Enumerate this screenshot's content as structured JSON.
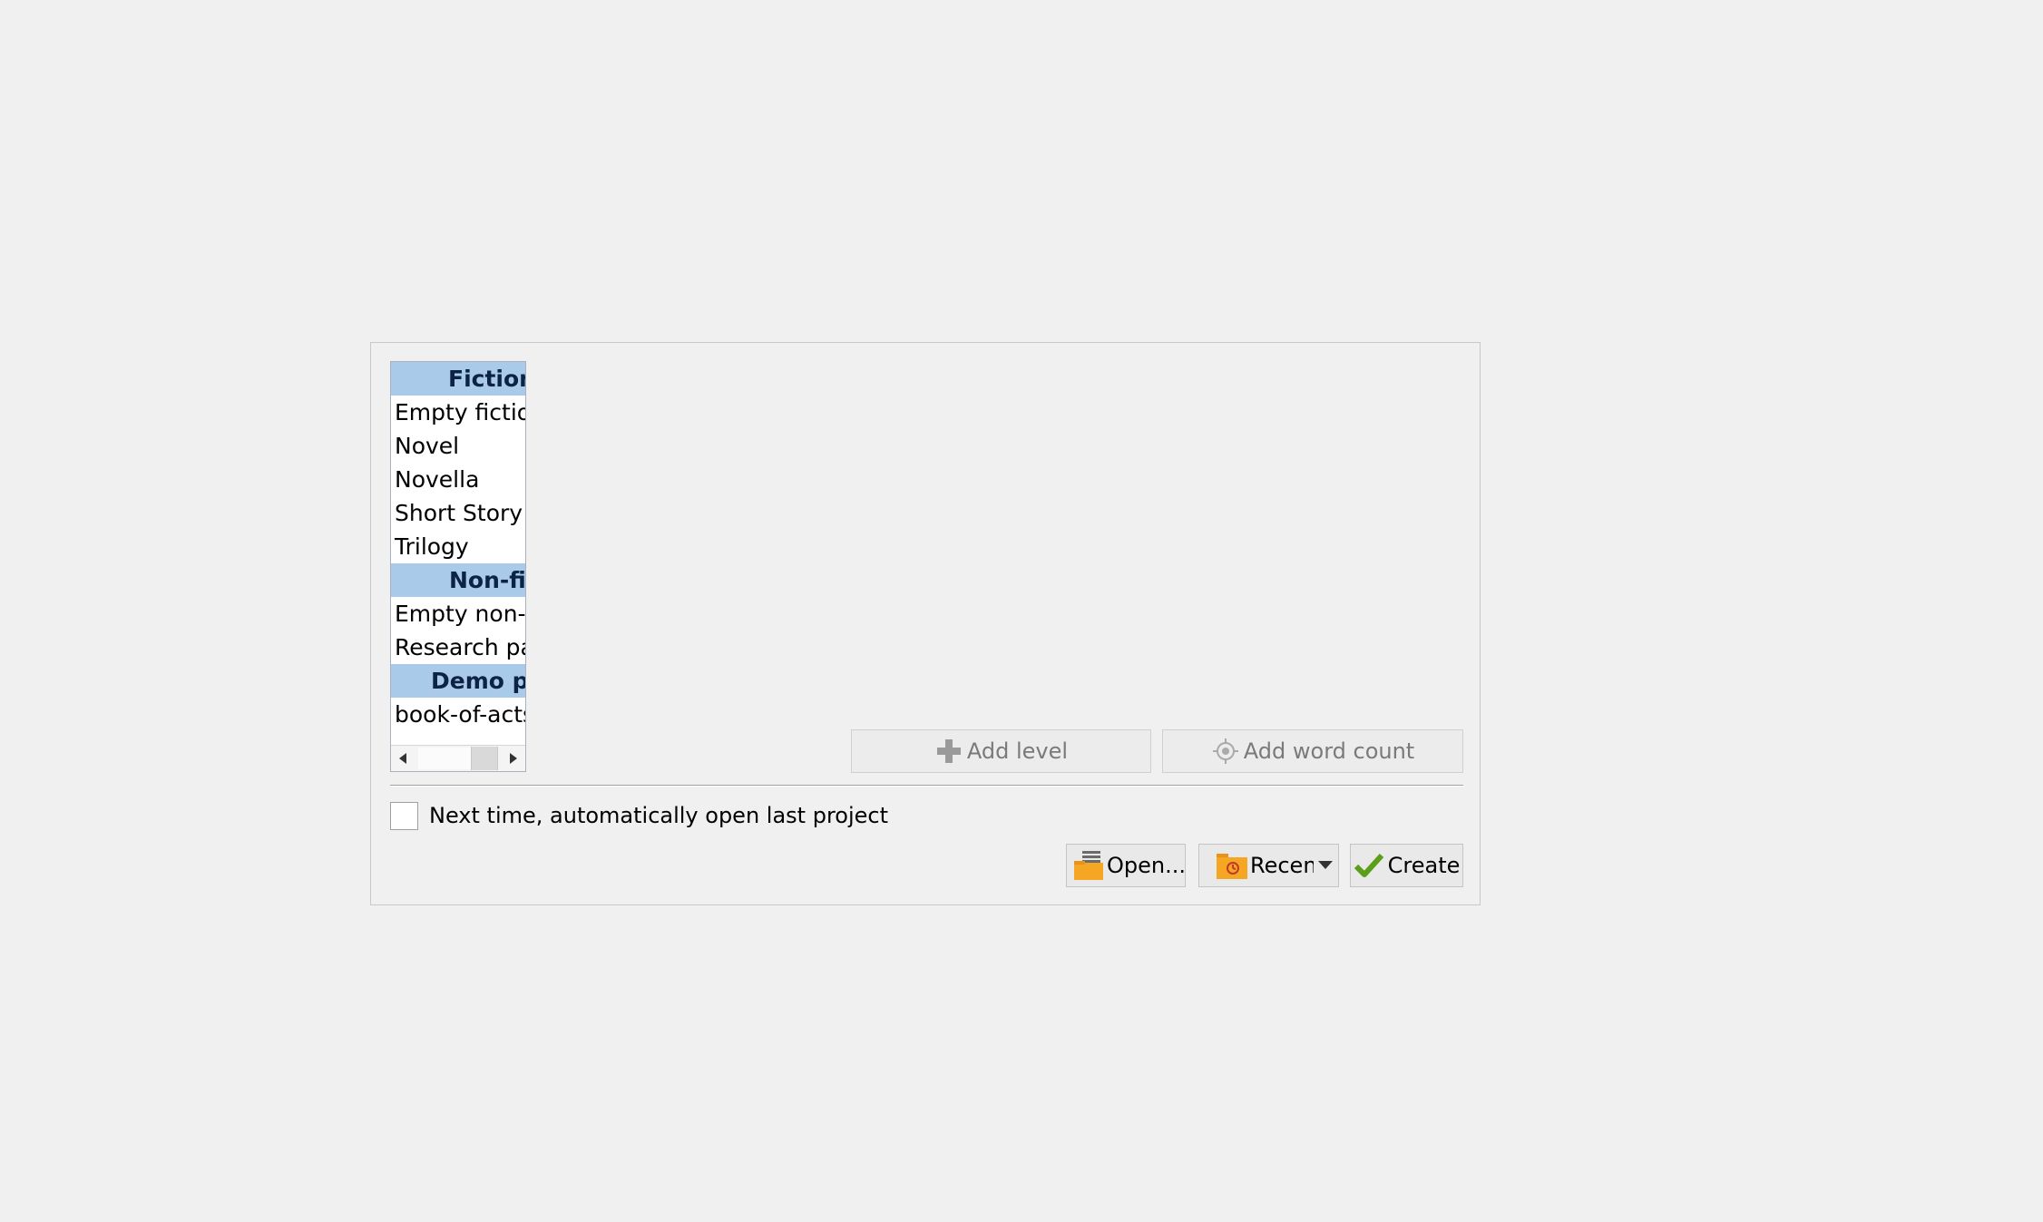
{
  "templates": {
    "groups": [
      {
        "header": "Fiction",
        "items": [
          "Empty fiction",
          "Novel",
          "Novella",
          "Short Story",
          "Trilogy"
        ]
      },
      {
        "header": "Non-fiction",
        "items": [
          "Empty non-fiction",
          "Research paper"
        ]
      },
      {
        "header": "Demo projects",
        "items": [
          "book-of-acts"
        ]
      }
    ]
  },
  "levels": {
    "add_level_label": "Add level",
    "add_word_count_label": "Add word count"
  },
  "options": {
    "auto_open_label": "Next time, automatically open last project",
    "auto_open_checked": false
  },
  "actions": {
    "open_label": "Open...",
    "recent_label": "Recent",
    "create_label": "Create"
  },
  "colors": {
    "header_bg": "#a9cbe9",
    "create_check": "#5a9e1a",
    "folder": "#f5a623"
  }
}
